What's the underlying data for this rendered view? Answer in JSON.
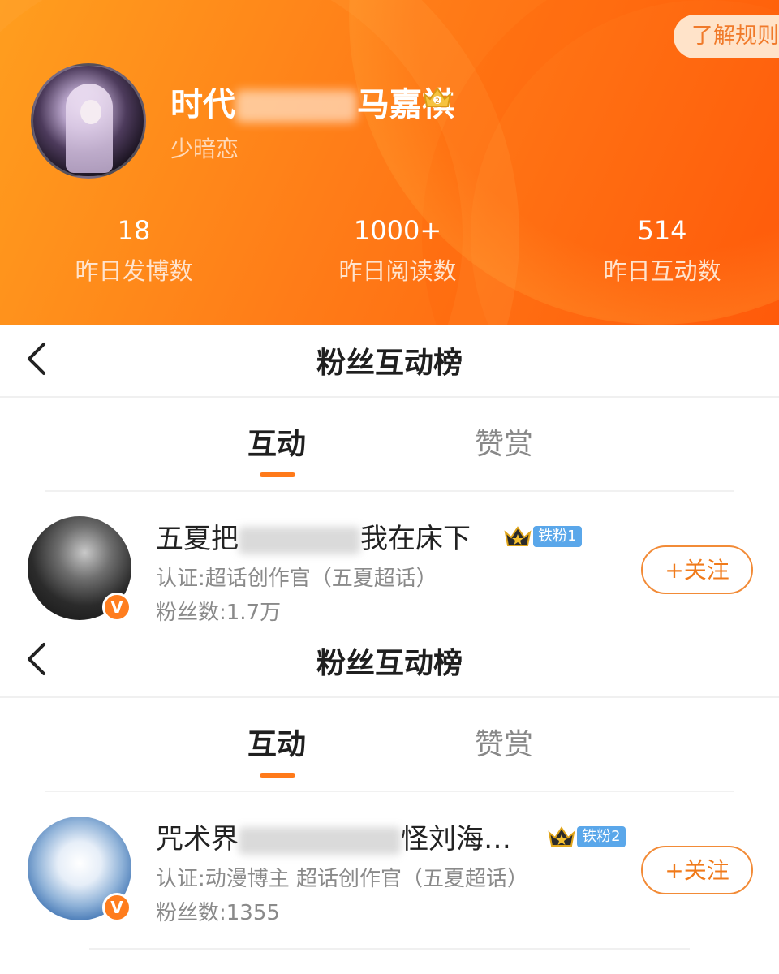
{
  "header": {
    "rules_button": "了解规则",
    "username_visible_start": "时代",
    "username_visible_end": "马嘉祺",
    "subname": "少暗恋",
    "stats": [
      {
        "value": "18",
        "label": "昨日发博数"
      },
      {
        "value": "1000+",
        "label": "昨日阅读数"
      },
      {
        "value": "514",
        "label": "昨日互动数"
      }
    ]
  },
  "sections": [
    {
      "title": "粉丝互动榜",
      "tabs": {
        "active": "互动",
        "inactive": "赞赏"
      },
      "user": {
        "name_start": "五夏把",
        "name_end": "我在床下",
        "fan_level": "铁粉1",
        "certification": "认证:超话创作官（五夏超话）",
        "fans": "粉丝数:1.7万",
        "follow_label": "+关注",
        "verified_mark": "V"
      }
    },
    {
      "title": "粉丝互动榜",
      "tabs": {
        "active": "互动",
        "inactive": "赞赏"
      },
      "user": {
        "name_start": "咒术界",
        "name_end": "怪刘海…",
        "fan_level": "铁粉2",
        "certification": "认证:动漫博主 超话创作官（五夏超话）",
        "fans": "粉丝数:1355",
        "follow_label": "+关注",
        "verified_mark": "V"
      }
    }
  ],
  "colors": {
    "header_gradient_start": "#ff9e1e",
    "header_gradient_end": "#ff5a0a",
    "accent": "#ff7a1a",
    "fan_badge": "#5aa7ea"
  },
  "icons": [
    "back-arrow-icon",
    "crown-icon",
    "verified-v-icon"
  ]
}
